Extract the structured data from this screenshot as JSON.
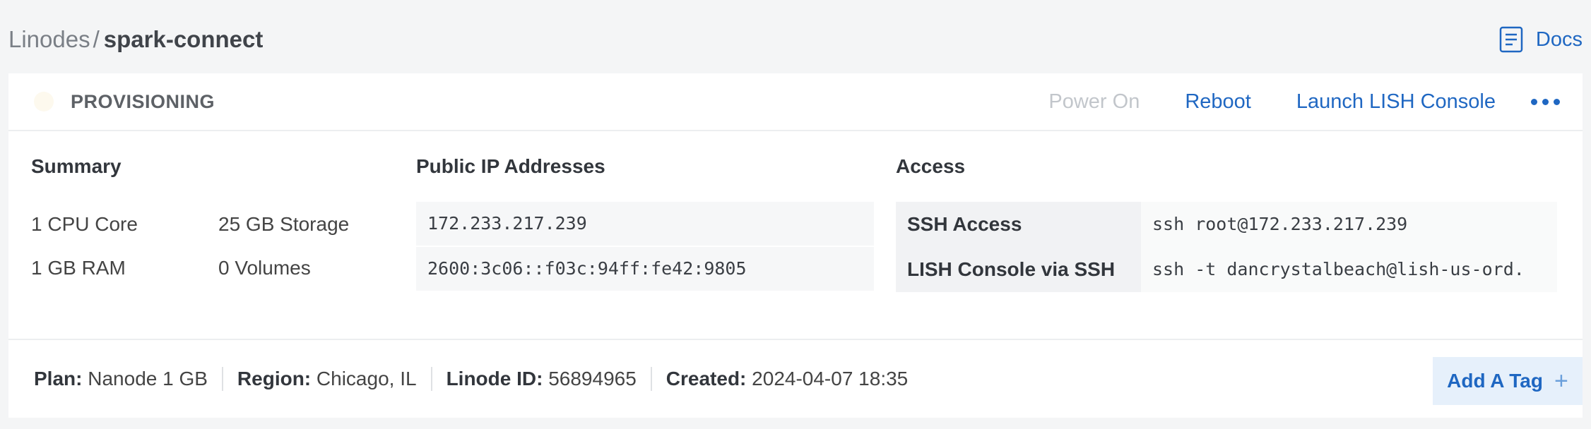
{
  "breadcrumb": {
    "parent": "Linodes",
    "separator": "/",
    "current": "spark-connect"
  },
  "header_links": {
    "docs": "Docs"
  },
  "linode": {
    "status": "PROVISIONING",
    "actions": {
      "power_on": "Power On",
      "reboot": "Reboot",
      "lish": "Launch LISH Console"
    }
  },
  "summary": {
    "title": "Summary",
    "cpu": "1 CPU Core",
    "storage": "25 GB Storage",
    "ram": "1 GB RAM",
    "volumes": "0 Volumes"
  },
  "ips": {
    "title": "Public IP Addresses",
    "ipv4": "172.233.217.239",
    "ipv6": "2600:3c06::f03c:94ff:fe42:9805"
  },
  "access": {
    "title": "Access",
    "rows": [
      {
        "label": "SSH Access",
        "value": "ssh root@172.233.217.239"
      },
      {
        "label": "LISH Console via SSH",
        "value": "ssh -t dancrystalbeach@lish-us-ord."
      }
    ]
  },
  "footer": {
    "plan_label": "Plan:",
    "plan": "Nanode 1 GB",
    "region_label": "Region:",
    "region": "Chicago, IL",
    "id_label": "Linode ID:",
    "id": "56894965",
    "created_label": "Created:",
    "created": "2024-04-07 18:35",
    "add_tag": "Add A Tag"
  },
  "colors": {
    "accent": "#1f67c2",
    "disabled": "#c2c6cb",
    "background": "#f4f5f6"
  }
}
